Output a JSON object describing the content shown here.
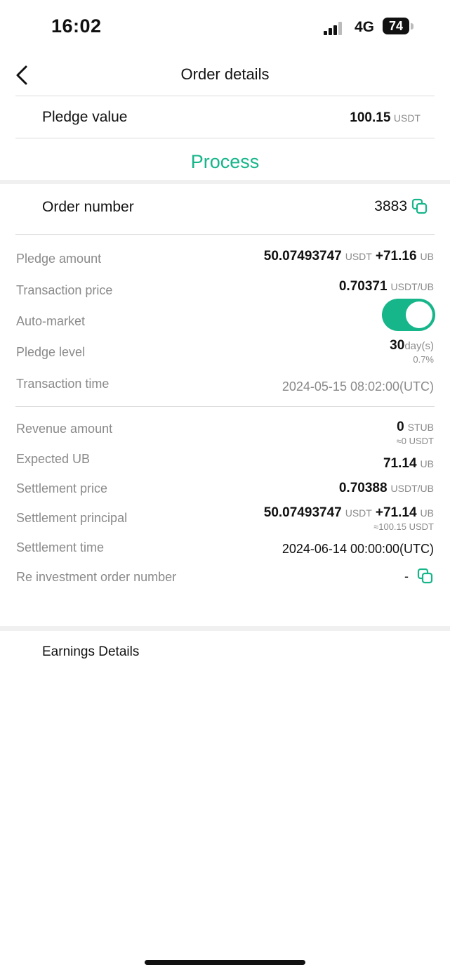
{
  "status_bar": {
    "time": "16:02",
    "network": "4G",
    "battery": "74"
  },
  "nav": {
    "title": "Order details"
  },
  "pledge_value": {
    "label": "Pledge value",
    "amount": "100.15",
    "unit": "USDT"
  },
  "process_label": "Process",
  "order_number": {
    "label": "Order number",
    "value": "3883"
  },
  "details": {
    "pledge_amount": {
      "label": "Pledge amount",
      "value": "50.07493747",
      "unit": "USDT",
      "extra": "+71.16",
      "extra_unit": "UB"
    },
    "transaction_price": {
      "label": "Transaction price",
      "value": "0.70371",
      "unit": "USDT/UB"
    },
    "auto_market": {
      "label": "Auto-market",
      "enabled": true
    },
    "pledge_level": {
      "label": "Pledge level",
      "days": "30",
      "days_unit": "day(s)",
      "rate": "0.7%"
    },
    "transaction_time": {
      "label": "Transaction time",
      "value": "2024-05-15 08:02:00(UTC)"
    }
  },
  "settlement": {
    "revenue_amount": {
      "label": "Revenue amount",
      "value": "0",
      "unit": "STUB",
      "approx": "≈0 USDT"
    },
    "expected_ub": {
      "label": "Expected UB",
      "value": "71.14",
      "unit": "UB"
    },
    "settlement_price": {
      "label": "Settlement price",
      "value": "0.70388",
      "unit": "USDT/UB"
    },
    "settlement_principal": {
      "label": "Settlement principal",
      "value": "50.07493747",
      "unit": "USDT",
      "extra": "+71.14",
      "extra_unit": "UB",
      "approx": "≈100.15 USDT"
    },
    "settlement_time": {
      "label": "Settlement time",
      "value": "2024-06-14 00:00:00(UTC)"
    },
    "reinvestment": {
      "label": "Re investment order number",
      "value": "-"
    }
  },
  "earnings": {
    "title": "Earnings Details"
  },
  "colors": {
    "accent": "#16b58a",
    "muted": "#8a8a8a",
    "divider": "#dcdcdc"
  },
  "icons": {
    "back": "chevron-left-icon",
    "copy": "copy-icon"
  }
}
